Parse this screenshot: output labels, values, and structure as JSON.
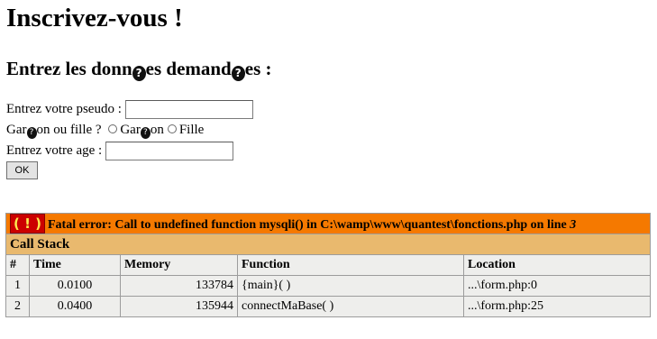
{
  "page": {
    "title": "Inscrivez-vous !",
    "subtitle_before": "Entrez les donn",
    "subtitle_middle": "es demand",
    "subtitle_after": "es :",
    "replacement_char": "?"
  },
  "form": {
    "pseudo_label": "Entrez votre pseudo :",
    "pseudo_value": "",
    "gender_label_before": "Gar",
    "gender_label_after": "on ou fille ?",
    "option_boy_before": "Gar",
    "option_boy_after": "on",
    "option_girl": "Fille",
    "age_label": "Entrez votre age :",
    "age_value": "",
    "submit_label": "OK"
  },
  "error": {
    "badge": "( ! )",
    "message": "Fatal error: Call to undefined function mysqli() in C:\\wamp\\www\\quantest\\fonctions.php on line ",
    "line": "3",
    "stack_title": "Call Stack",
    "columns": [
      "#",
      "Time",
      "Memory",
      "Function",
      "Location"
    ],
    "rows": [
      {
        "num": "1",
        "time": "0.0100",
        "memory": "133784",
        "function": "{main}( )",
        "location": "...\\form.php:0"
      },
      {
        "num": "2",
        "time": "0.0400",
        "memory": "135944",
        "function": "connectMaBase( )",
        "location": "...\\form.php:25"
      }
    ]
  },
  "colors": {
    "fatal_bg": "#f57900",
    "stack_bg": "#e9b96e",
    "cell_bg": "#eeeeec",
    "badge_bg": "#cc0000"
  }
}
